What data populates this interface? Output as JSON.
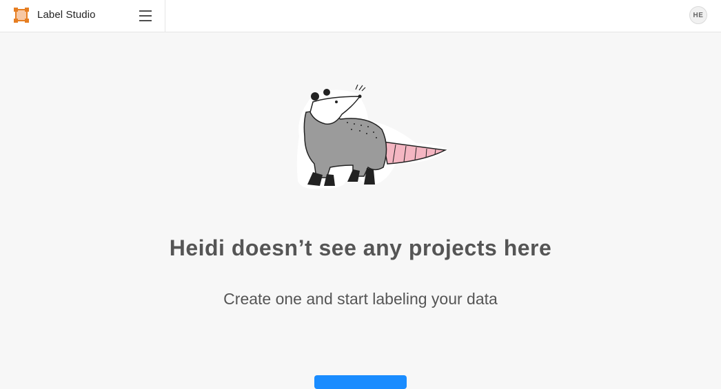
{
  "app": {
    "name": "Label Studio"
  },
  "header": {
    "menu_icon": "hamburger-menu-icon",
    "user_initials": "HE"
  },
  "empty_state": {
    "illustration": "opossum-illustration",
    "heading": "Heidi doesn’t see any projects here",
    "subheading": "Create one and start labeling your data",
    "create_button_label": ""
  },
  "colors": {
    "brand": "#e67e22",
    "accent": "#1a8cff",
    "background": "#f7f7f7"
  }
}
